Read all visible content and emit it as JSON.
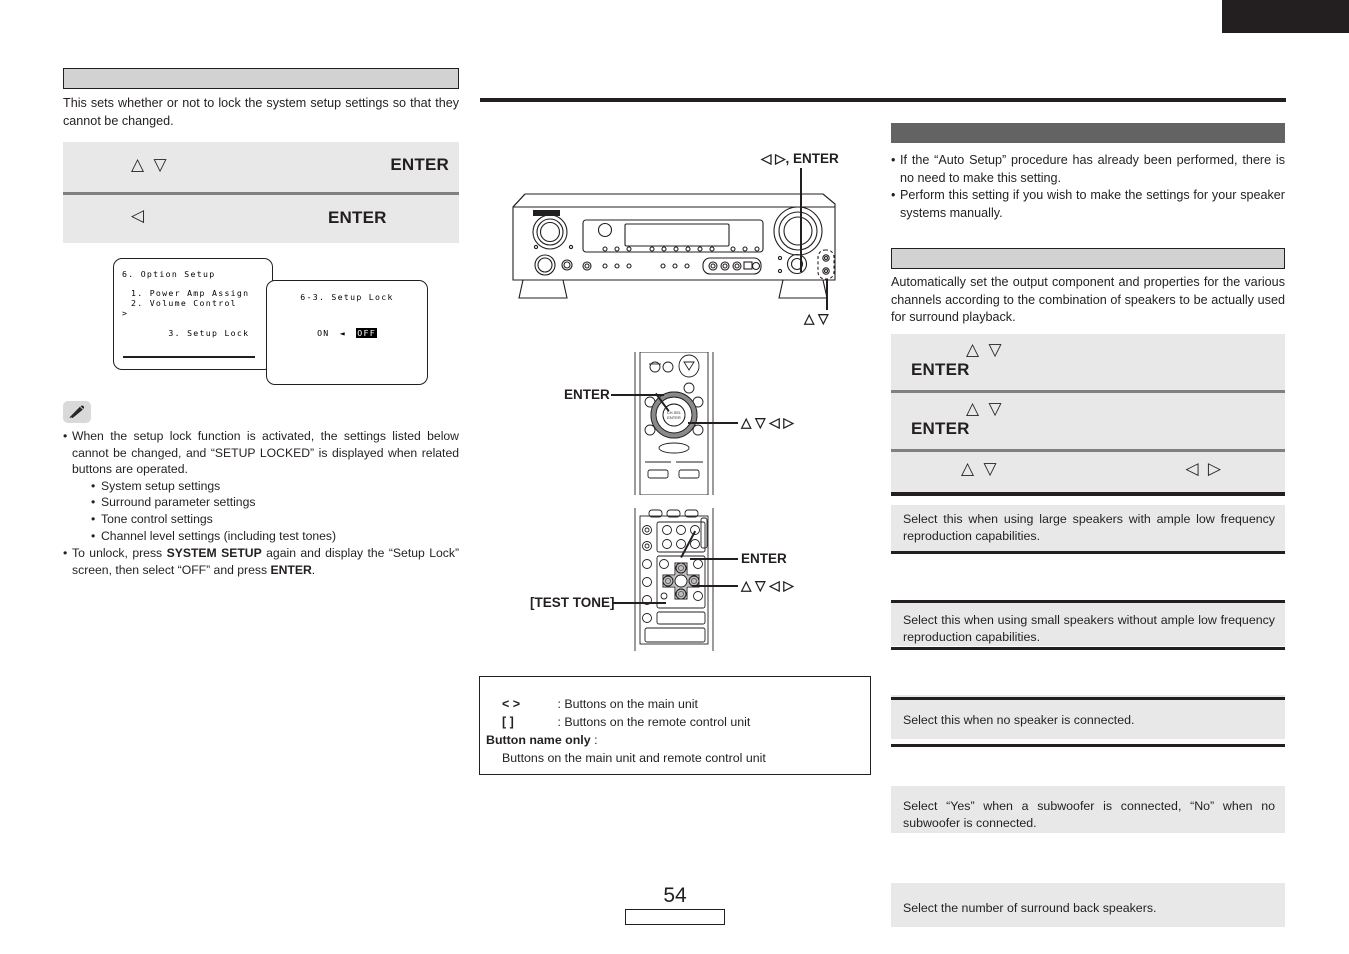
{
  "page": {
    "number": "54",
    "tab_marker": ""
  },
  "left_column": {
    "section_header": "",
    "intro_paragraph": "This sets whether or not to lock the system setup settings so that they cannot be changed.",
    "steps": [
      {
        "arrows": "△ ▽",
        "action": "ENTER"
      },
      {
        "arrows": "◁",
        "action": "ENTER"
      }
    ],
    "osd_menu": {
      "title": "6. Option Setup",
      "items": [
        "1. Power Amp Assign",
        "2. Volume Control",
        "3. Setup Lock"
      ],
      "selected_index": 2,
      "cursor": ">"
    },
    "osd_detail": {
      "title": "6-3. Setup Lock",
      "option_left": "ON",
      "option_arrow": "◄",
      "option_right": "OFF",
      "selected": "OFF"
    },
    "note": {
      "icon": "pencil-icon",
      "bullets": [
        "When the setup lock function is activated, the settings listed below cannot be changed, and “SETUP LOCKED” is displayed when related buttons are operated."
      ],
      "sub_bullets": [
        "System setup settings",
        "Surround parameter settings",
        "Tone control settings",
        "Channel level settings (including test tones)"
      ],
      "unlock_text_parts": [
        "To unlock, press ",
        "SYSTEM SETUP",
        " again and display the “Setup Lock” screen, then select “OFF” and press ",
        "ENTER",
        "."
      ]
    }
  },
  "middle_column": {
    "main_unit": {
      "callout_top": "◁ ▷, ENTER",
      "callout_bottom": "△ ▽",
      "brand": "DENON"
    },
    "remote_upper": {
      "callout_left": "ENTER",
      "callout_right": "△ ▽ ◁ ▷"
    },
    "remote_lower": {
      "callout_left": "[TEST TONE]",
      "callout_right_1": "ENTER",
      "callout_right_2": "△ ▽ ◁ ▷"
    },
    "legend": {
      "rows": [
        {
          "symbol": "<     >",
          "desc": ": Buttons on the main unit"
        },
        {
          "symbol": "[     ]",
          "desc": ": Buttons on the remote control unit"
        }
      ],
      "bold_label": "Button name only",
      "bold_label_colon": " :",
      "bold_label_desc": "Buttons on the main unit and remote control unit"
    }
  },
  "right_column": {
    "section_header_dark": "",
    "notes": [
      "If the “Auto Setup” procedure has already been performed, there is no need to make this setting.",
      "Perform this setting if you wish to make the settings for your speaker systems manually."
    ],
    "subsection_header": "",
    "description": "Automatically set the output component and properties for the various channels according to the combination of speakers to be actually used for surround playback.",
    "steps": [
      {
        "arrows": "△ ▽",
        "action": "ENTER"
      },
      {
        "arrows": "△ ▽",
        "action": "ENTER"
      },
      {
        "arrows_left": "△ ▽",
        "arrows_right": "◁ ▷",
        "action": ""
      }
    ],
    "table_rows": [
      "Select this when using large speakers with ample low frequency reproduction capabilities.",
      "Select this when using small speakers without ample low frequency reproduction capabilities.",
      "Select this when no speaker is connected.",
      "Select “Yes” when a subwoofer is connected, “No” when no subwoofer is connected.",
      "Select the number of surround back speakers."
    ]
  },
  "colors": {
    "ink": "#231f20",
    "header_light": "#d2d2d2",
    "header_dark": "#636363",
    "block_gray": "#e8e8e8",
    "separator_gray": "#808080"
  }
}
